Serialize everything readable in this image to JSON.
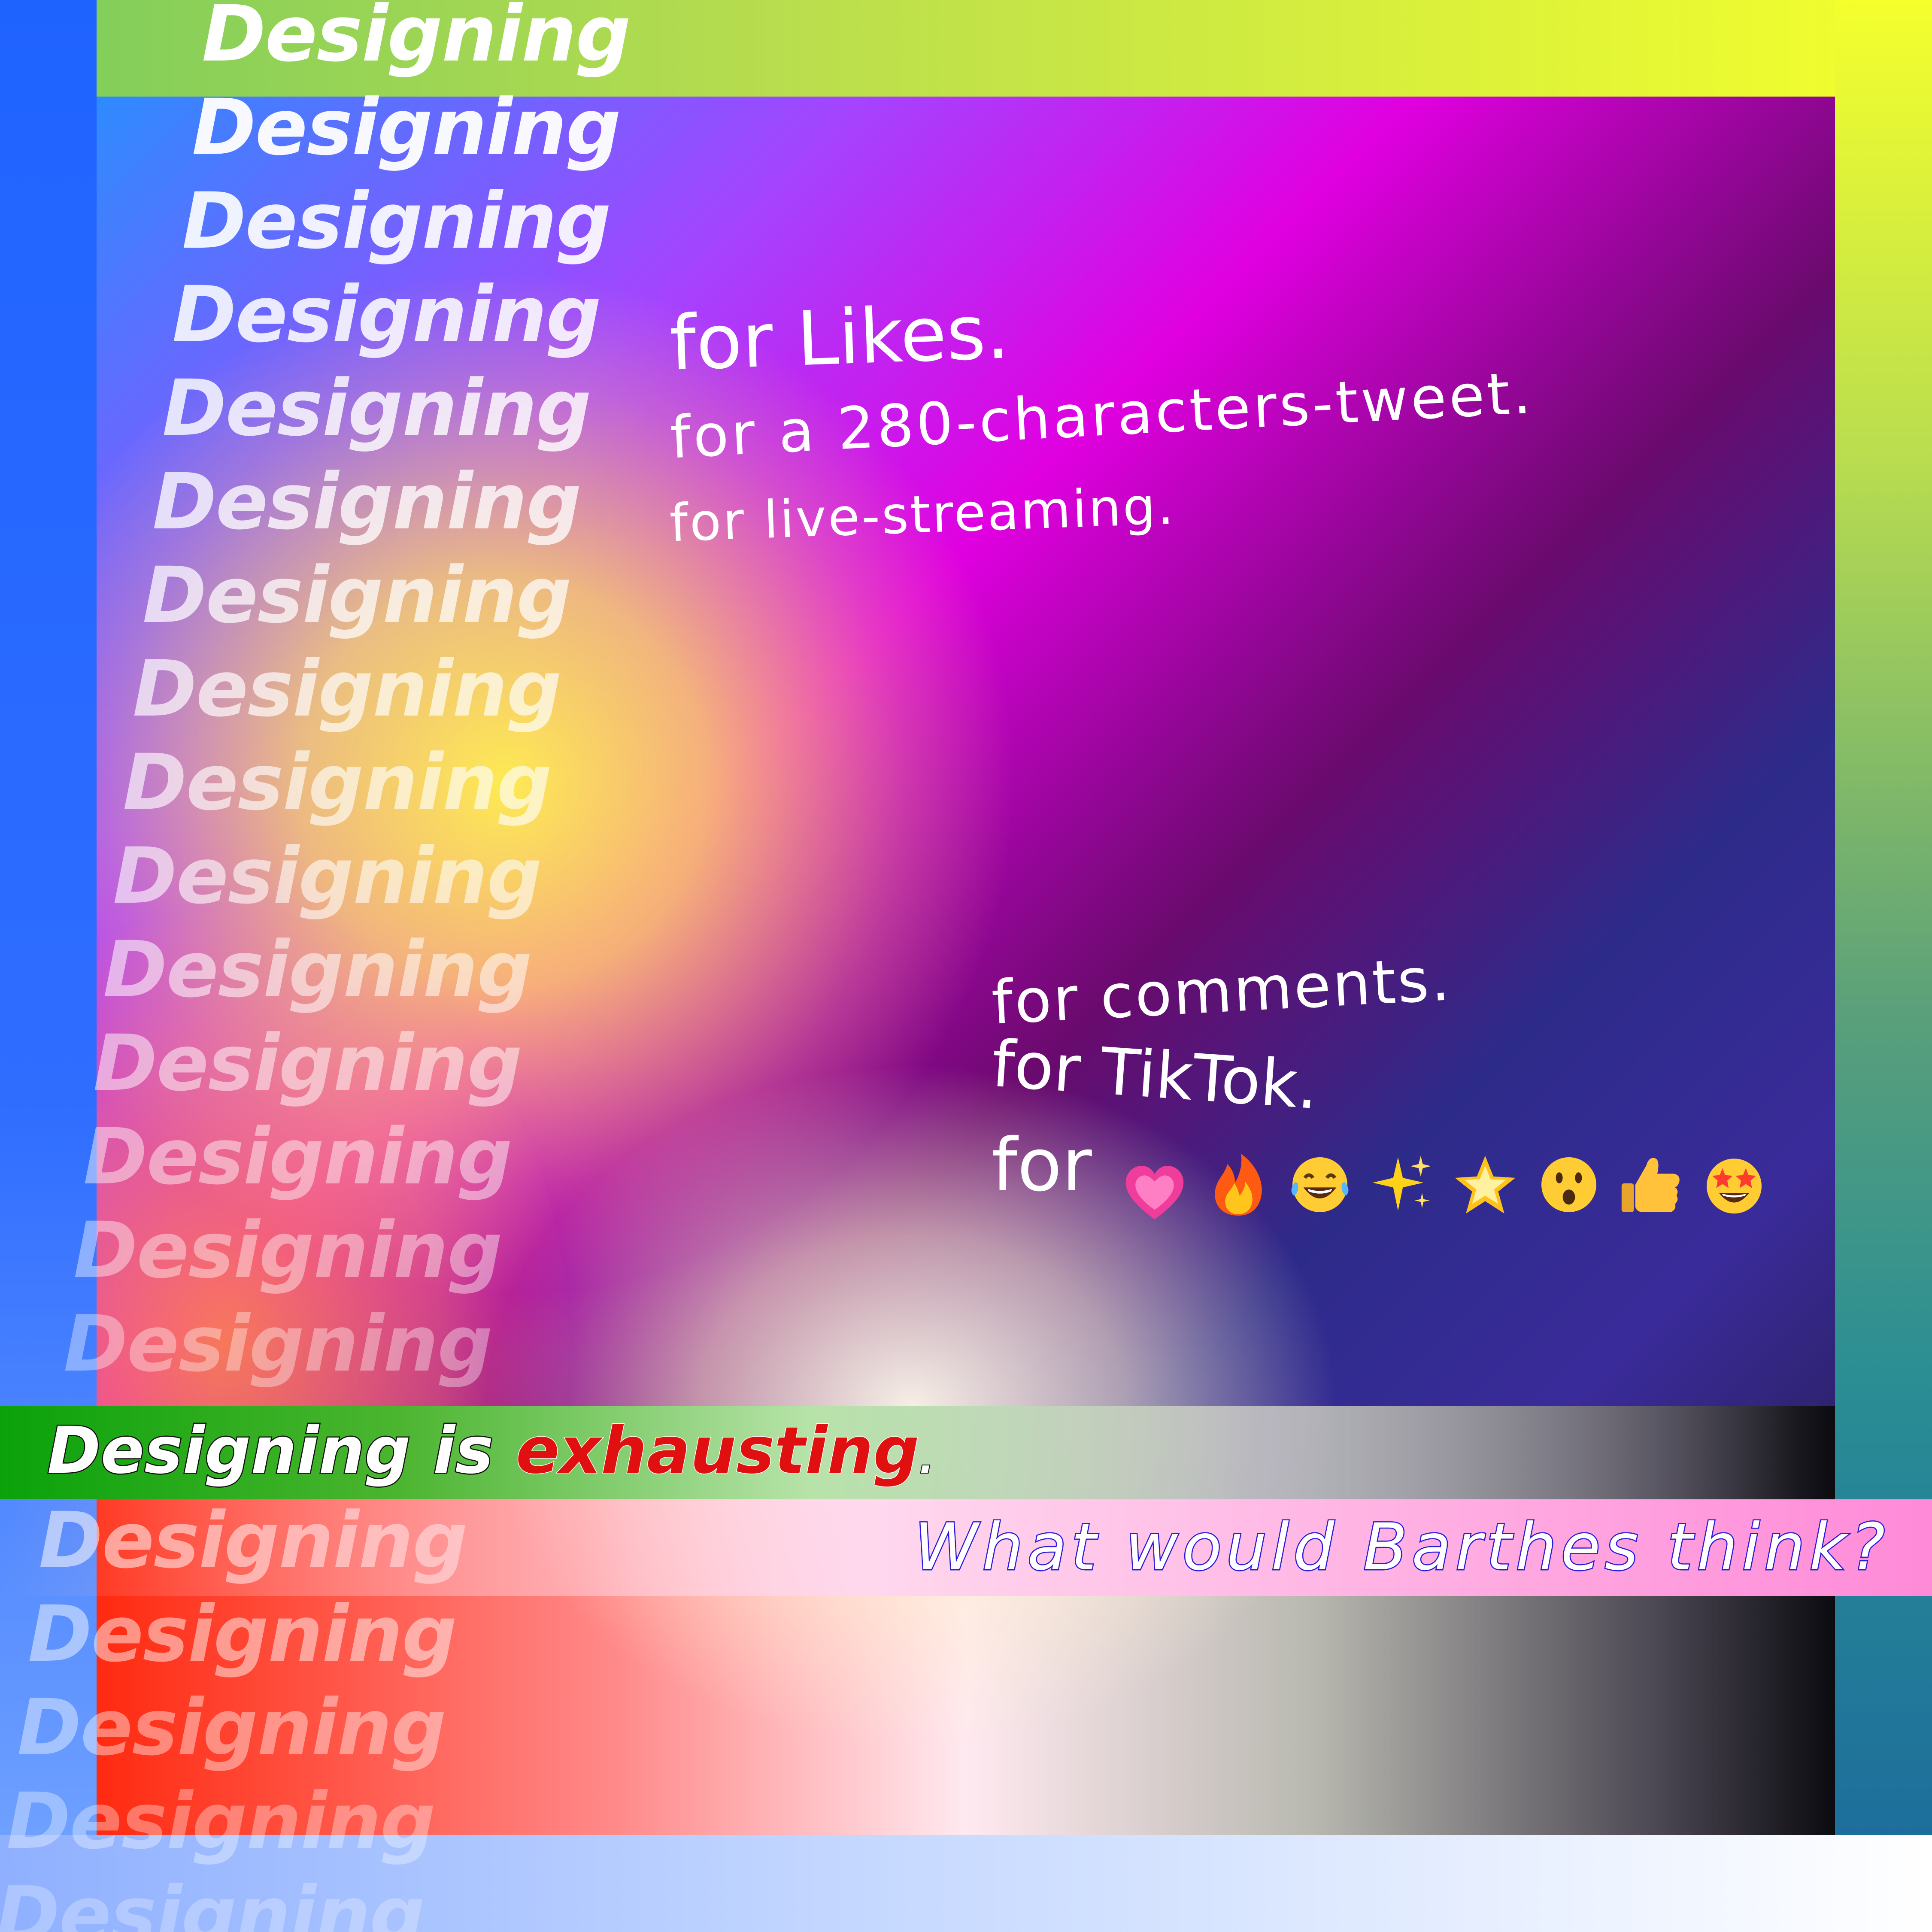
{
  "stack_word": "Designing",
  "lines_top": [
    "for Likes.",
    "for a 280-characters-tweet.",
    "for live-streaming."
  ],
  "lines_bottom": [
    "for comments.",
    "for TikTok.",
    "for"
  ],
  "emoji_icons": [
    "heart-emoji",
    "fire-emoji",
    "laughing-tears-emoji",
    "sparkles-emoji",
    "glowing-star-emoji",
    "surprised-face-emoji",
    "thumbs-up-emoji",
    "star-struck-emoji"
  ],
  "headline": {
    "prefix": "Designing is ",
    "emphasis": "exhausting",
    "suffix": "."
  },
  "question": "What would Barthes think?",
  "colors": {
    "headline_emphasis": "#e01010",
    "question_outline": "#2a1adb",
    "frame_left": "#1f63ff",
    "frame_top_right": "#f4ff2c"
  }
}
